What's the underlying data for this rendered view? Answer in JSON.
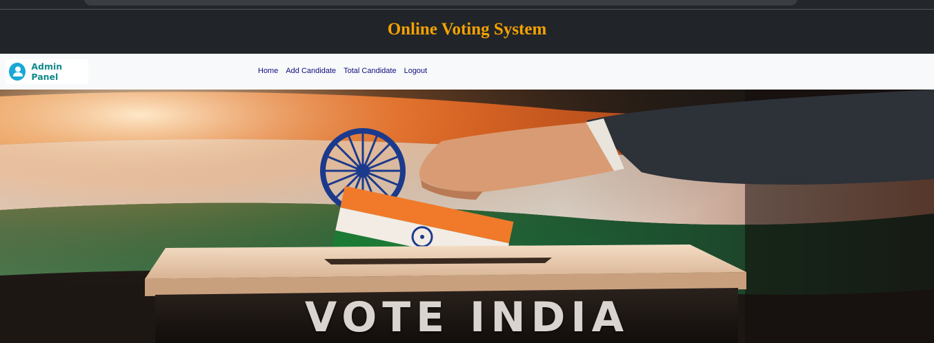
{
  "header": {
    "title": "Online Voting System"
  },
  "navbar": {
    "brand": {
      "label": "Admin Panel",
      "icon": "user-icon"
    },
    "links": [
      {
        "label": "Home"
      },
      {
        "label": "Add Candidate"
      },
      {
        "label": "Total Candidate"
      },
      {
        "label": "Logout"
      }
    ]
  },
  "hero": {
    "text": "VOTE INDIA"
  },
  "colors": {
    "title": "#f5a200",
    "brand": "#138a8a",
    "nav_link": "#0d0d80",
    "saffron": "#f26b1d",
    "green": "#1b7a3a",
    "chakra": "#1b3a8c"
  }
}
